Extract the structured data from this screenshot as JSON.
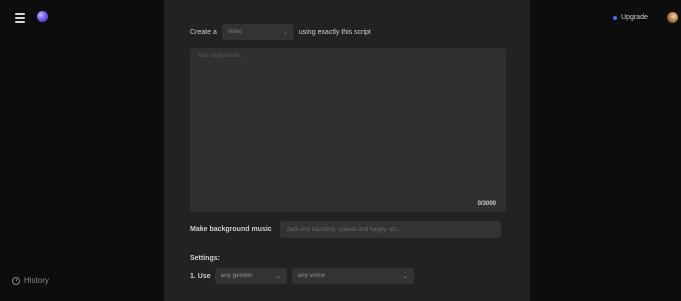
{
  "sidebar": {
    "history_label": "History"
  },
  "header": {
    "upgrade_label": "Upgrade"
  },
  "create_row": {
    "prefix": "Create a",
    "type_value": "video",
    "suffix": "using exactly this script"
  },
  "script": {
    "placeholder": "Your script here...",
    "char_count": "0/3000"
  },
  "music": {
    "label": "Make background music",
    "placeholder": "dark and haunting, upbeat and happy, etc..."
  },
  "settings": {
    "label": "Settings:",
    "use_label": "1. Use",
    "gender_value": "any gender",
    "voice_value": "any voice"
  },
  "icons": {
    "menu": "menu-icon",
    "logo": "logo-icon",
    "history": "clock-icon",
    "chevron": "chevron-down-icon",
    "upgrade": "dot-icon"
  },
  "colors": {
    "background": "#111111",
    "panel": "#222222",
    "input": "#333333",
    "accent": "#4b6bff"
  }
}
